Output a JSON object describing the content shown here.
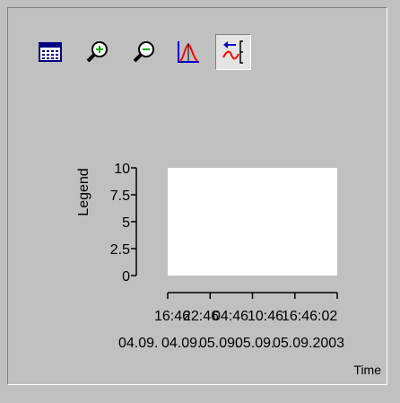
{
  "toolbar": {
    "buttons": [
      {
        "name": "data-table-icon",
        "active": false
      },
      {
        "name": "zoom-in-icon",
        "active": false
      },
      {
        "name": "zoom-out-icon",
        "active": false
      },
      {
        "name": "chart-type-icon",
        "active": false
      },
      {
        "name": "scroll-axis-icon",
        "active": true
      }
    ]
  },
  "chart_data": {
    "type": "line",
    "ylabel": "Legend",
    "xlabel": "Time",
    "ylim": [
      0,
      10
    ],
    "y_ticks": [
      "10",
      "7.5",
      "5",
      "2.5",
      "0"
    ],
    "x_tick_times": [
      "16:46",
      "22:46",
      "04:46",
      "10:46",
      "16:46:02"
    ],
    "x_tick_dates": [
      "04.09.",
      "04.09.",
      "05.09.",
      "05.09.",
      "05.09.2003"
    ],
    "series": [],
    "plot_background": "#ffffff"
  },
  "colors": {
    "window_bg": "#c0c0c0",
    "plot_bg": "#ffffff",
    "accent_red": "#ff0000",
    "accent_blue": "#0000cc",
    "accent_green": "#00aa00"
  }
}
